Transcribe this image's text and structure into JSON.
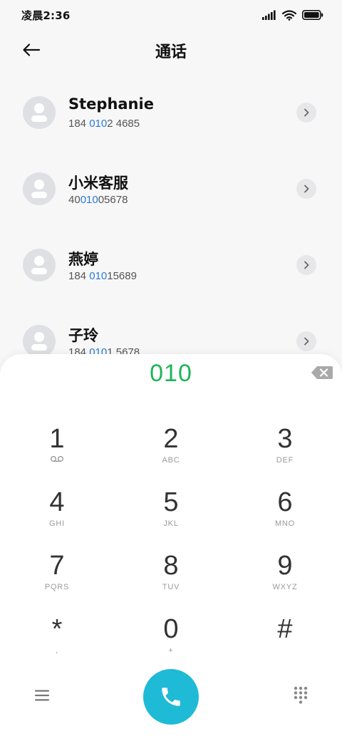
{
  "status_bar": {
    "time": "凌晨2:36",
    "icons": [
      "signal-icon",
      "wifi-icon",
      "battery-icon"
    ]
  },
  "header": {
    "title": "通话",
    "back_icon": "arrow-left-icon"
  },
  "contacts": [
    {
      "name": "Stephanie",
      "number_parts": [
        "184 ",
        "010",
        "2 4685"
      ]
    },
    {
      "name": "小米客服",
      "number_parts": [
        "40",
        "010",
        "05678"
      ]
    },
    {
      "name": "燕婷",
      "number_parts": [
        "184 ",
        "010",
        "15689"
      ]
    },
    {
      "name": "子玲",
      "number_parts": [
        "184 ",
        "010",
        "1 5678"
      ]
    }
  ],
  "dialpad": {
    "input": "010",
    "keys": [
      {
        "digit": "1",
        "letters": ""
      },
      {
        "digit": "2",
        "letters": "ABC"
      },
      {
        "digit": "3",
        "letters": "DEF"
      },
      {
        "digit": "4",
        "letters": "GHI"
      },
      {
        "digit": "5",
        "letters": "JKL"
      },
      {
        "digit": "6",
        "letters": "MNO"
      },
      {
        "digit": "7",
        "letters": "PQRS"
      },
      {
        "digit": "8",
        "letters": "TUV"
      },
      {
        "digit": "9",
        "letters": "WXYZ"
      },
      {
        "digit": "*",
        "letters": ","
      },
      {
        "digit": "0",
        "letters": "+"
      },
      {
        "digit": "#",
        "letters": ""
      }
    ]
  },
  "colors": {
    "accent_green": "#1eb45a",
    "highlight_blue": "#2a7ad6",
    "call_button": "#1fbad6"
  }
}
